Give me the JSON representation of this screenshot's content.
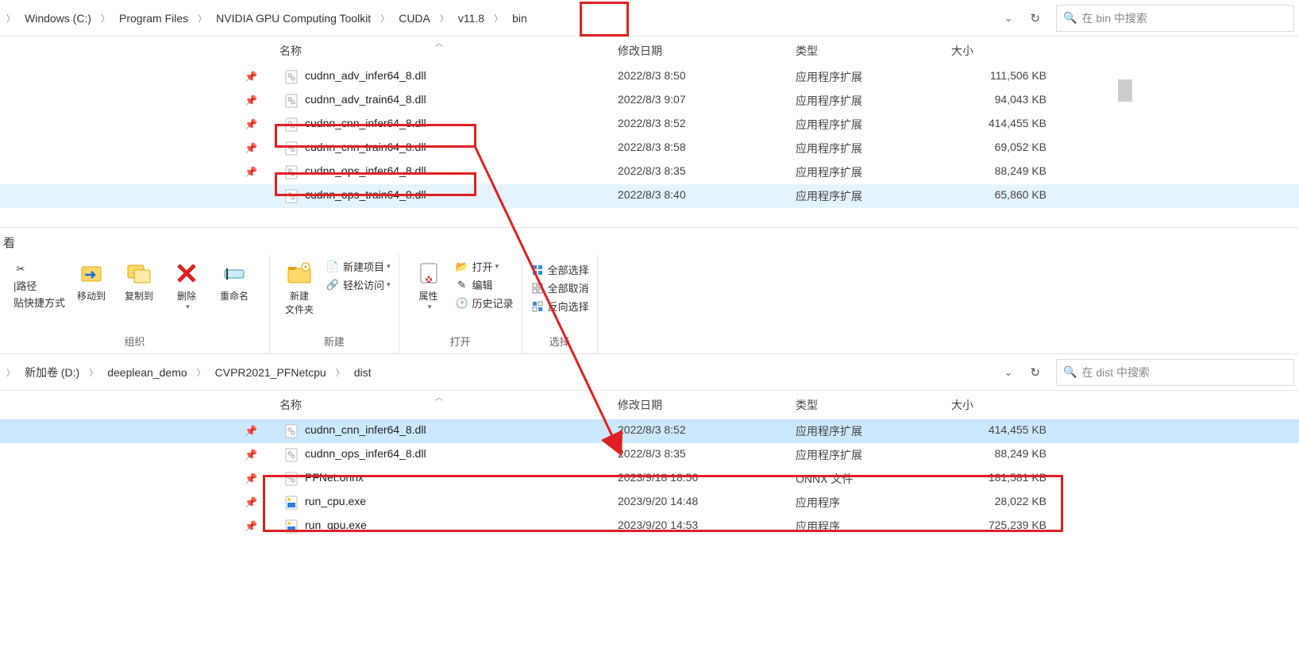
{
  "window1": {
    "breadcrumb": [
      "Windows (C:)",
      "Program Files",
      "NVIDIA GPU Computing Toolkit",
      "CUDA",
      "v11.8",
      "bin"
    ],
    "search_placeholder": "在 bin 中搜索",
    "columns": {
      "name": "名称",
      "date": "修改日期",
      "type": "类型",
      "size": "大小"
    },
    "rows": [
      {
        "name": "cudnn_adv_infer64_8.dll",
        "date": "2022/8/3 8:50",
        "type": "应用程序扩展",
        "size": "111,506 KB",
        "icon": "dll",
        "pinned": true
      },
      {
        "name": "cudnn_adv_train64_8.dll",
        "date": "2022/8/3 9:07",
        "type": "应用程序扩展",
        "size": "94,043 KB",
        "icon": "dll",
        "pinned": true
      },
      {
        "name": "cudnn_cnn_infer64_8.dll",
        "date": "2022/8/3 8:52",
        "type": "应用程序扩展",
        "size": "414,455 KB",
        "icon": "dll",
        "pinned": true
      },
      {
        "name": "cudnn_cnn_train64_8.dll",
        "date": "2022/8/3 8:58",
        "type": "应用程序扩展",
        "size": "69,052 KB",
        "icon": "dll",
        "pinned": true
      },
      {
        "name": "cudnn_ops_infer64_8.dll",
        "date": "2022/8/3 8:35",
        "type": "应用程序扩展",
        "size": "88,249 KB",
        "icon": "dll",
        "pinned": true
      },
      {
        "name": "cudnn_ops_train64_8.dll",
        "date": "2022/8/3 8:40",
        "type": "应用程序扩展",
        "size": "65,860 KB",
        "icon": "dll",
        "pinned": false,
        "hover": true
      }
    ]
  },
  "ribbon": {
    "tab": "看",
    "group_org": "组织",
    "group_new": "新建",
    "group_open": "打开",
    "group_select": "选择",
    "paths_label": "|路径",
    "shortcut_label": "贴快捷方式",
    "move_to": "移动到",
    "copy_to": "复制到",
    "delete": "删除",
    "rename": "重命名",
    "new_folder": "新建\n文件夹",
    "new_item": "新建项目",
    "easy_access": "轻松访问",
    "properties": "属性",
    "open": "打开",
    "edit": "编辑",
    "history": "历史记录",
    "select_all": "全部选择",
    "select_none": "全部取消",
    "invert_sel": "反向选择"
  },
  "window2": {
    "breadcrumb": [
      "新加卷 (D:)",
      "deeplean_demo",
      "CVPR2021_PFNetcpu",
      "dist"
    ],
    "search_placeholder": "在 dist 中搜索",
    "columns": {
      "name": "名称",
      "date": "修改日期",
      "type": "类型",
      "size": "大小"
    },
    "rows": [
      {
        "name": "cudnn_cnn_infer64_8.dll",
        "date": "2022/8/3 8:52",
        "type": "应用程序扩展",
        "size": "414,455 KB",
        "icon": "dll",
        "pinned": true,
        "sel": true
      },
      {
        "name": "cudnn_ops_infer64_8.dll",
        "date": "2022/8/3 8:35",
        "type": "应用程序扩展",
        "size": "88,249 KB",
        "icon": "dll",
        "pinned": true
      },
      {
        "name": "PFNet.onnx",
        "date": "2023/9/18 18:56",
        "type": "ONNX 文件",
        "size": "181,581 KB",
        "icon": "dll",
        "pinned": true
      },
      {
        "name": "run_cpu.exe",
        "date": "2023/9/20 14:48",
        "type": "应用程序",
        "size": "28,022 KB",
        "icon": "exe",
        "pinned": true
      },
      {
        "name": "run_gpu.exe",
        "date": "2023/9/20 14:53",
        "type": "应用程序",
        "size": "725,239 KB",
        "icon": "exe",
        "pinned": true
      }
    ]
  }
}
